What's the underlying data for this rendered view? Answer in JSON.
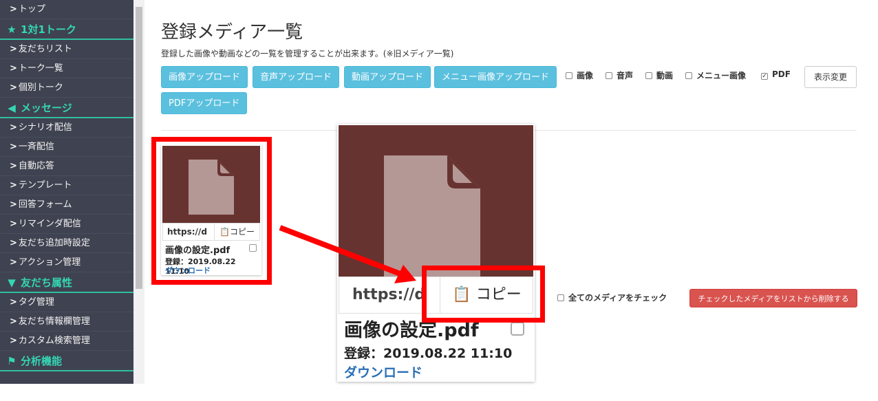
{
  "sidebar": {
    "items": [
      {
        "type": "item",
        "label": "トップ"
      },
      {
        "type": "head",
        "icon": "star-icon",
        "glyph": "★",
        "label": "1対1トーク"
      },
      {
        "type": "item",
        "label": "友だちリスト"
      },
      {
        "type": "item",
        "label": "トーク一覧"
      },
      {
        "type": "item",
        "label": "個別トーク"
      },
      {
        "type": "head",
        "icon": "megaphone-icon",
        "glyph": "◀",
        "label": "メッセージ"
      },
      {
        "type": "item",
        "label": "シナリオ配信"
      },
      {
        "type": "item",
        "label": "一斉配信"
      },
      {
        "type": "item",
        "label": "自動応答"
      },
      {
        "type": "item",
        "label": "テンプレート"
      },
      {
        "type": "item",
        "label": "回答フォーム"
      },
      {
        "type": "item",
        "label": "リマインダ配信"
      },
      {
        "type": "item",
        "label": "友だち追加時設定"
      },
      {
        "type": "item",
        "label": "アクション管理"
      },
      {
        "type": "head",
        "icon": "filter-icon",
        "glyph": "▼",
        "label": "友だち属性"
      },
      {
        "type": "item",
        "label": "タグ管理"
      },
      {
        "type": "item",
        "label": "友だち情報欄管理"
      },
      {
        "type": "item",
        "label": "カスタム検索管理"
      },
      {
        "type": "head",
        "icon": "flag-icon",
        "glyph": "⚑",
        "label": "分析機能"
      }
    ]
  },
  "main": {
    "title": "登録メディア一覧",
    "description": "登録した画像や動画などの一覧を管理することが出来ます。(※旧メディア一覧)",
    "upload_buttons": [
      "画像アップロード",
      "音声アップロード",
      "動画アップロード",
      "メニュー画像アップロード",
      "PDFアップロード"
    ],
    "filters": [
      {
        "label": "画像",
        "checked": false
      },
      {
        "label": "音声",
        "checked": false
      },
      {
        "label": "動画",
        "checked": false
      },
      {
        "label": "メニュー画像",
        "checked": false
      },
      {
        "label": "PDF",
        "checked": true
      }
    ],
    "display_button": "表示変更"
  },
  "media_card": {
    "url": "https://d",
    "copy_label": "コピー",
    "filename": "画像の設定.pdf",
    "registered": "登録：2019.08.22 11:10",
    "download": "ダウンロード"
  },
  "bulk": {
    "check_all": "全てのメディアをチェック",
    "delete_button": "チェックしたメディアをリストから削除する"
  },
  "colors": {
    "sidebar_bg": "#3f4250",
    "accent_teal": "#34d6b4",
    "info_button": "#5bc0de",
    "danger_button": "#d9534f",
    "thumb_bg": "#673330",
    "annotation_red": "#ff0000"
  }
}
